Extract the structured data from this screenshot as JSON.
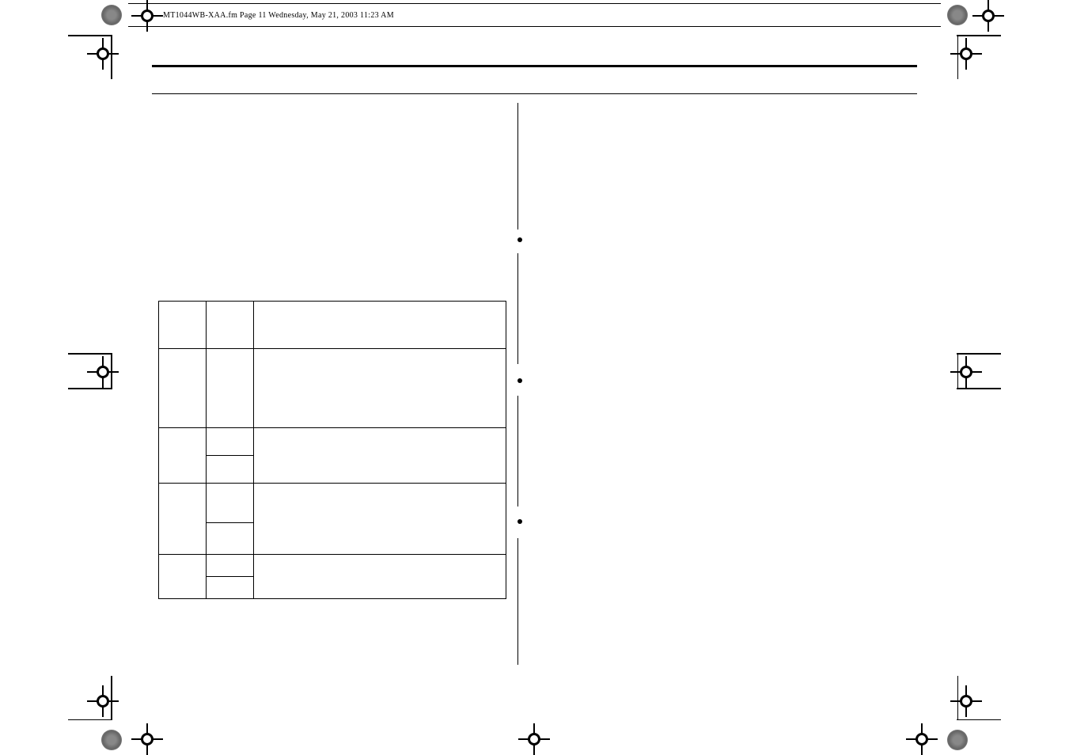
{
  "header": {
    "text": "MT1044WB-XAA.fm  Page 11  Wednesday, May 21, 2003  11:23 AM"
  }
}
